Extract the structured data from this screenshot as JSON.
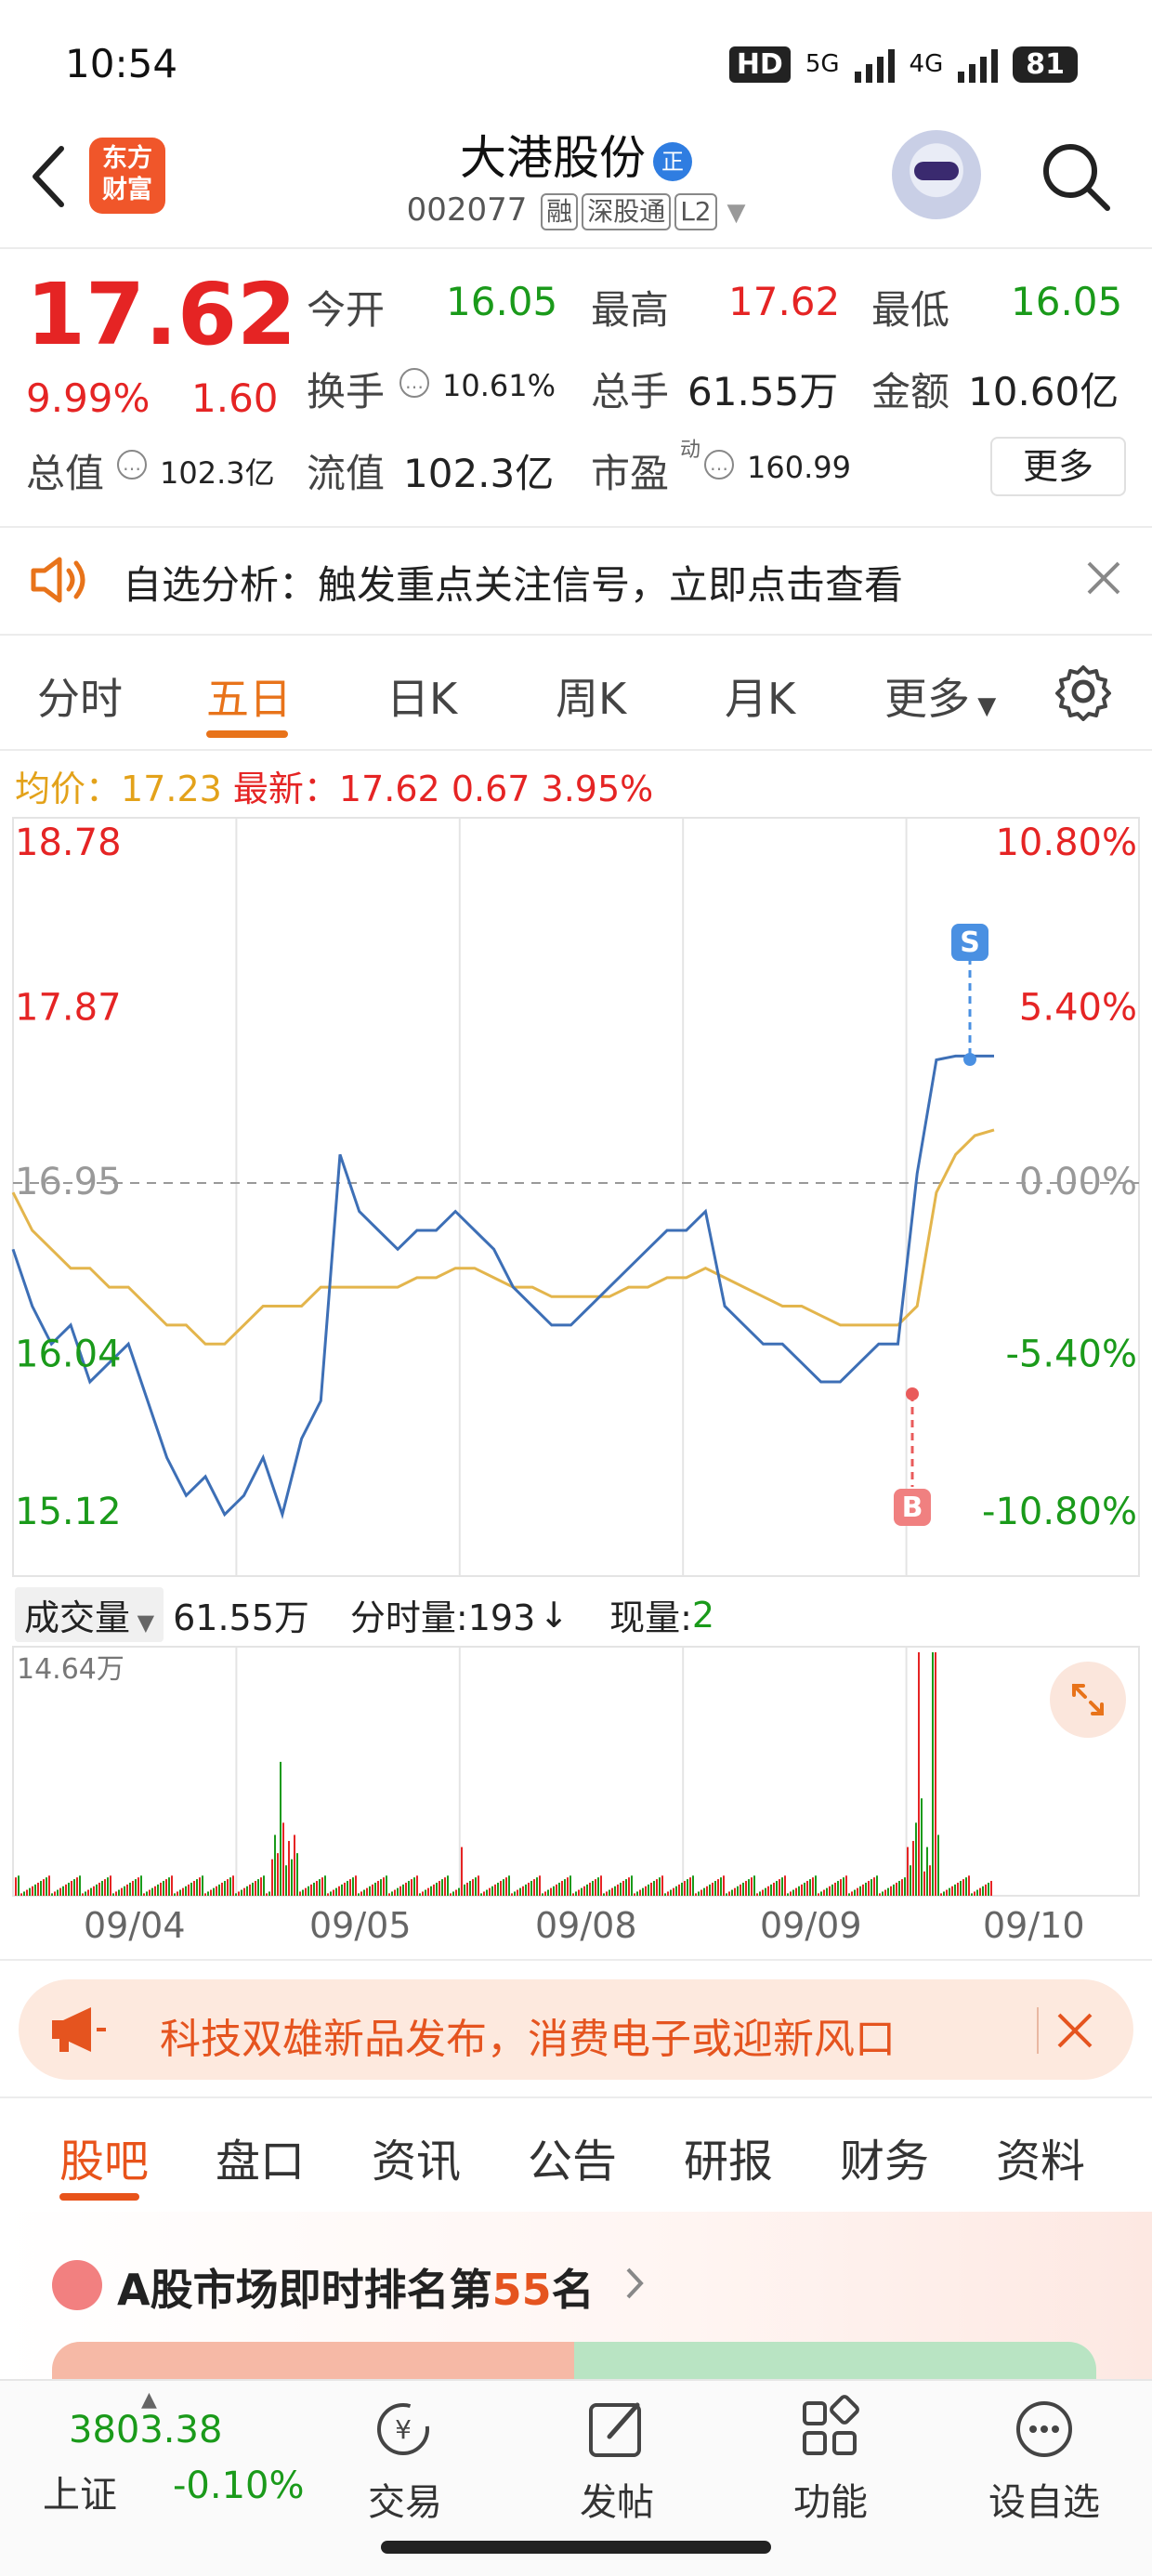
{
  "status_bar": {
    "time": "10:54",
    "hd": "HD",
    "net": "5G",
    "net2": "4G",
    "battery": "81"
  },
  "header": {
    "logo_line1": "东方",
    "logo_line2": "财富",
    "stock_name": "大港股份",
    "name_badge": "正",
    "code": "002077",
    "tags": [
      "融",
      "深股通",
      "L2"
    ]
  },
  "quote": {
    "price": "17.62",
    "pct": "9.99%",
    "change": "1.60",
    "open_label": "今开",
    "open": "16.05",
    "high_label": "最高",
    "high": "17.62",
    "low_label": "最低",
    "low": "16.05",
    "turnover_label": "换手",
    "turnover": "10.61%",
    "volume_label": "总手",
    "volume": "61.55万",
    "amount_label": "金额",
    "amount": "10.60亿",
    "mcap_label": "总值",
    "mcap": "102.3亿",
    "float_label": "流值",
    "float": "102.3亿",
    "pe_label": "市盈",
    "pe_sup": "动",
    "pe": "160.99",
    "more_label": "更多"
  },
  "notice": {
    "text": "自选分析：触发重点关注信号，立即点击查看"
  },
  "tabs": [
    "分时",
    "五日",
    "日K",
    "周K",
    "月K",
    "更多"
  ],
  "active_tab": "五日",
  "avg_line": {
    "avg_label": "均价：",
    "avg": "17.23",
    "latest_label": "最新：",
    "latest": "17.62",
    "chg": "0.67",
    "pct": "3.95%"
  },
  "chart_data": {
    "type": "line",
    "y_left_ticks": [
      "18.78",
      "17.87",
      "16.95",
      "16.04",
      "15.12"
    ],
    "y_right_ticks": [
      "10.80%",
      "5.40%",
      "0.00%",
      "-5.40%",
      "-10.80%"
    ],
    "ylim": [
      15.12,
      18.78
    ],
    "prev_close": 16.95,
    "dates": [
      "09/04",
      "09/05",
      "09/08",
      "09/09",
      "09/10"
    ],
    "series": [
      {
        "values": [
          16.6,
          16.3,
          16.1,
          16.2,
          15.9,
          16.0,
          16.1,
          15.8,
          15.5,
          15.3,
          15.4,
          15.2,
          15.3,
          15.5,
          15.2,
          15.6,
          15.8,
          17.1,
          16.8,
          16.7,
          16.6,
          16.7,
          16.7,
          16.8,
          16.7,
          16.6,
          16.4,
          16.3,
          16.2,
          16.2,
          16.3,
          16.4,
          16.5,
          16.6,
          16.7,
          16.7,
          16.8,
          16.3,
          16.2,
          16.1,
          16.1,
          16.0,
          15.9,
          15.9,
          16.0,
          16.1,
          16.1,
          17.0,
          17.6,
          17.62,
          17.62,
          17.62
        ]
      },
      {
        "values": [
          16.9,
          16.7,
          16.6,
          16.5,
          16.5,
          16.4,
          16.4,
          16.3,
          16.2,
          16.2,
          16.1,
          16.1,
          16.2,
          16.3,
          16.3,
          16.3,
          16.4,
          16.4,
          16.4,
          16.4,
          16.4,
          16.45,
          16.45,
          16.5,
          16.5,
          16.45,
          16.4,
          16.4,
          16.35,
          16.35,
          16.35,
          16.35,
          16.4,
          16.4,
          16.45,
          16.45,
          16.5,
          16.45,
          16.4,
          16.35,
          16.3,
          16.3,
          16.25,
          16.2,
          16.2,
          16.2,
          16.2,
          16.3,
          16.9,
          17.1,
          17.2,
          17.23
        ]
      }
    ],
    "markers": [
      "S",
      "B"
    ],
    "volume_peak": "14.64万"
  },
  "volume": {
    "label": "成交量",
    "total": "61.55万",
    "tick_label": "分时量:193",
    "now_label": "现量:",
    "now": "2"
  },
  "ad": {
    "text": "科技双雄新品发布，消费电子或迎新风口"
  },
  "lower_tabs": [
    "股吧",
    "盘口",
    "资讯",
    "公告",
    "研报",
    "财务",
    "资料"
  ],
  "rank": {
    "prefix": "A股市场即时排名第",
    "num": "55",
    "suffix": "名"
  },
  "bottom_nav": {
    "index_value": "3803.38",
    "index_name": "上证",
    "index_change": "-0.10%",
    "items": [
      "交易",
      "发帖",
      "功能",
      "设自选"
    ]
  },
  "colors": {
    "up": "#e52424",
    "down": "#1a9a1a",
    "accent": "#e8731a",
    "price_line": "#3d6fb6",
    "avg_line": "#e3b54c"
  }
}
